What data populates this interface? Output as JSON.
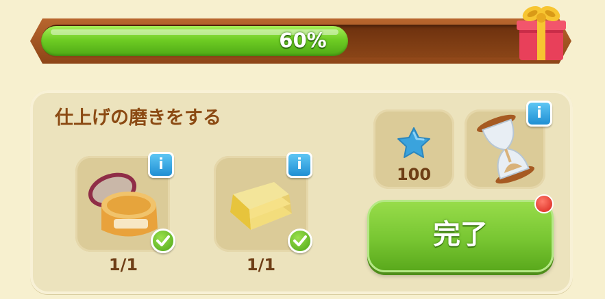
{
  "progress": {
    "value": 0.6,
    "label": "60%"
  },
  "reward": {
    "icon": "gift-box-icon"
  },
  "task": {
    "title": "仕上げの磨きをする",
    "items": [
      {
        "icon": "polish-jar-icon",
        "count": "1/1",
        "completed": true
      },
      {
        "icon": "polishing-cloth-icon",
        "count": "1/1",
        "completed": true
      }
    ],
    "star_reward": {
      "icon": "blue-star-icon",
      "value": "100"
    },
    "timer": {
      "icon": "hourglass-icon"
    },
    "complete_button": {
      "label": "完了"
    }
  },
  "colors": {
    "accent_green": "#78c632",
    "title_brown": "#8b4a13",
    "info_blue": "#1f8fd3"
  }
}
